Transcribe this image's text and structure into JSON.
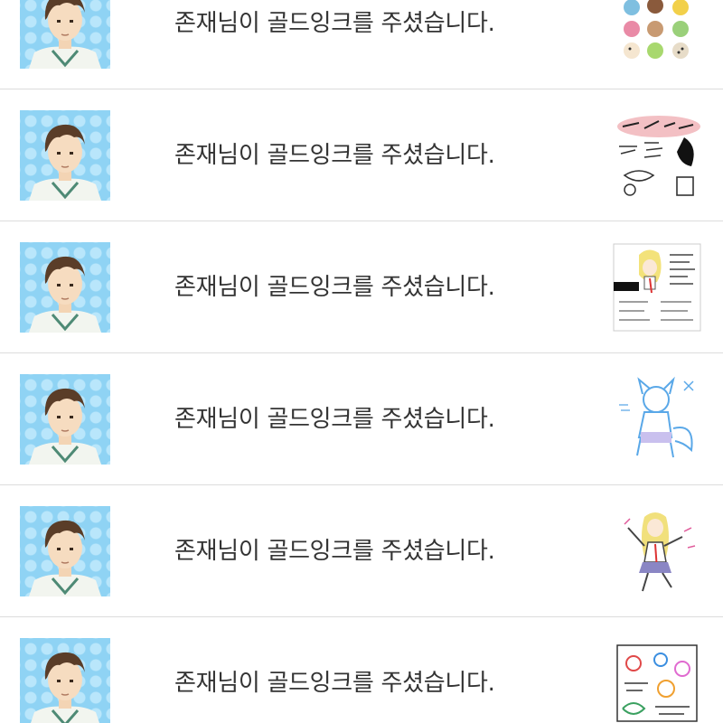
{
  "notifications": [
    {
      "message": "존재님이 골드잉크를 주셨습니다.",
      "avatar_icon": "user-avatar-icon",
      "thumbnail": "ice-cream-drawing"
    },
    {
      "message": "존재님이 골드잉크를 주셨습니다.",
      "avatar_icon": "user-avatar-icon",
      "thumbnail": "handwritten-doodle"
    },
    {
      "message": "존재님이 골드잉크를 주셨습니다.",
      "avatar_icon": "user-avatar-icon",
      "thumbnail": "girl-character-sheet"
    },
    {
      "message": "존재님이 골드잉크를 주셨습니다.",
      "avatar_icon": "user-avatar-icon",
      "thumbnail": "blue-fox-boy-sketch"
    },
    {
      "message": "존재님이 골드잉크를 주셨습니다.",
      "avatar_icon": "user-avatar-icon",
      "thumbnail": "running-girl-sketch"
    },
    {
      "message": "존재님이 골드잉크를 주셨습니다.",
      "avatar_icon": "user-avatar-icon",
      "thumbnail": "colorful-doodle-page"
    }
  ],
  "colors": {
    "avatar_bg": "#8fd3f4",
    "text": "#333333",
    "divider": "#dcdcdc"
  }
}
